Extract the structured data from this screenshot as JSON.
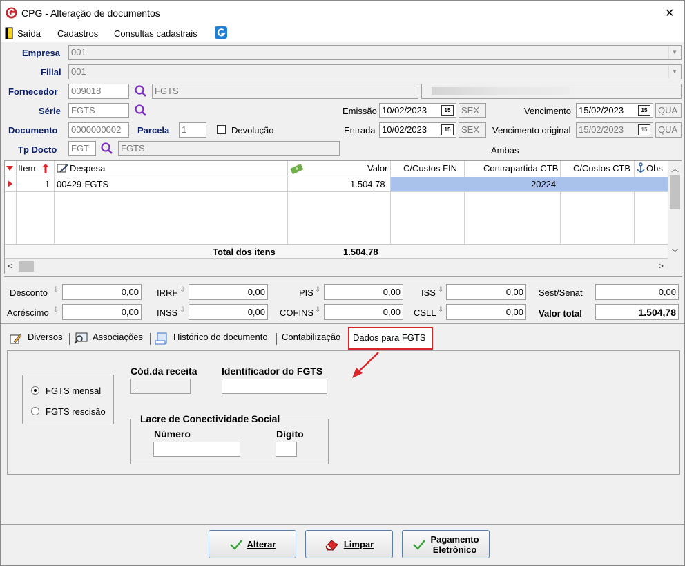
{
  "window": {
    "title": "CPG - Alteração de documentos",
    "close": "✕"
  },
  "menu": {
    "items": [
      "Saída",
      "Cadastros",
      "Consultas cadastrais"
    ]
  },
  "form": {
    "empresa_label": "Empresa",
    "empresa_value": "001",
    "filial_label": "Filial",
    "filial_value": "001",
    "fornecedor_label": "Fornecedor",
    "fornecedor_code": "009018",
    "fornecedor_name": "FGTS",
    "serie_label": "Série",
    "serie_value": "FGTS",
    "documento_label": "Documento",
    "documento_value": "0000000002",
    "parcela_label": "Parcela",
    "parcela_value": "1",
    "devolucao_label": "Devolução",
    "tpdocto_label": "Tp Docto",
    "tpdocto_code": "FGT",
    "tpdocto_name": "FGTS",
    "emissao_label": "Emissão",
    "emissao_value": "10/02/2023",
    "emissao_day": "SEX",
    "entrada_label": "Entrada",
    "entrada_value": "10/02/2023",
    "entrada_day": "SEX",
    "vencimento_label": "Vencimento",
    "vencimento_value": "15/02/2023",
    "vencimento_day": "QUA",
    "venc_original_label": "Vencimento original",
    "venc_original_value": "15/02/2023",
    "venc_original_day": "QUA",
    "ambas_label": "Ambas",
    "cal_icon_text": "15"
  },
  "grid": {
    "columns": [
      "Item",
      "Despesa",
      "Valor",
      "C/Custos FIN",
      "Contrapartida CTB",
      "C/Custos CTB",
      "Obs"
    ],
    "rows": [
      {
        "item": "1",
        "despesa": "00429-FGTS",
        "valor": "1.504,78",
        "cc_fin": "",
        "contrapartida": "20224",
        "cc_ctb": ""
      }
    ],
    "total_label": "Total dos itens",
    "total_value": "1.504,78"
  },
  "totals": {
    "desconto_label": "Desconto",
    "desconto": "0,00",
    "acrescimo_label": "Acréscimo",
    "acrescimo": "0,00",
    "irrf_label": "IRRF",
    "irrf": "0,00",
    "inss_label": "INSS",
    "inss": "0,00",
    "pis_label": "PIS",
    "pis": "0,00",
    "cofins_label": "COFINS",
    "cofins": "0,00",
    "iss_label": "ISS",
    "iss": "0,00",
    "csll_label": "CSLL",
    "csll": "0,00",
    "sestsenat_label": "Sest/Senat",
    "sestsenat": "0,00",
    "valortotal_label": "Valor total",
    "valortotal": "1.504,78"
  },
  "tabs": [
    "Diversos",
    "Associações",
    "Histórico do documento",
    "Contabilização",
    "Dados para FGTS"
  ],
  "fgts": {
    "radio_mensal": "FGTS mensal",
    "radio_rescisao": "FGTS rescisão",
    "cod_receita_label": "Cód.da receita",
    "identificador_label": "Identificador do FGTS",
    "lacre_label": "Lacre de Conectividade Social",
    "numero_label": "Número",
    "digito_label": "Dígito"
  },
  "buttons": {
    "alterar": "Alterar",
    "limpar": "Limpar",
    "pagamento_line1": "Pagamento",
    "pagamento_line2": "Eletrônico"
  },
  "colors": {
    "accent": "#0b1f6b",
    "selection": "#a9c2ec",
    "highlight_border": "#d9262b",
    "arrow": "#d9262b"
  }
}
